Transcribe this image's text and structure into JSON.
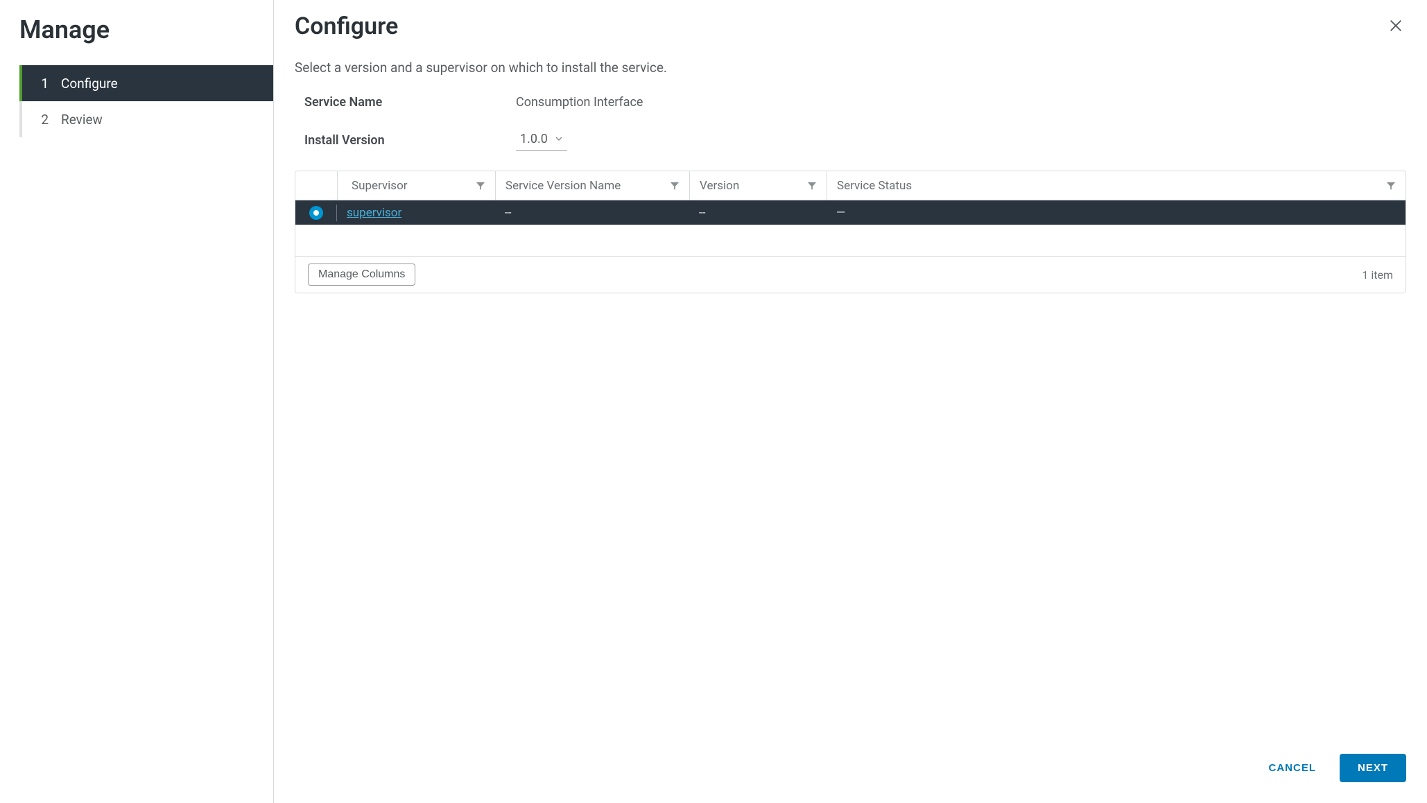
{
  "sidebar": {
    "title": "Manage",
    "steps": [
      {
        "num": "1",
        "label": "Configure",
        "active": true
      },
      {
        "num": "2",
        "label": "Review",
        "active": false
      }
    ]
  },
  "main": {
    "title": "Configure",
    "subtitle": "Select a version and a supervisor on which to install the service.",
    "service_name_label": "Service Name",
    "service_name_value": "Consumption Interface",
    "install_version_label": "Install Version",
    "install_version_value": "1.0.0"
  },
  "table": {
    "columns": {
      "supervisor": "Supervisor",
      "service_version_name": "Service Version Name",
      "version": "Version",
      "service_status": "Service Status"
    },
    "rows": [
      {
        "selected": true,
        "supervisor": "supervisor",
        "service_version_name": "--",
        "version": "--",
        "service_status": "—"
      }
    ],
    "manage_columns_label": "Manage Columns",
    "item_count": "1 item"
  },
  "footer": {
    "cancel": "CANCEL",
    "next": "NEXT"
  }
}
